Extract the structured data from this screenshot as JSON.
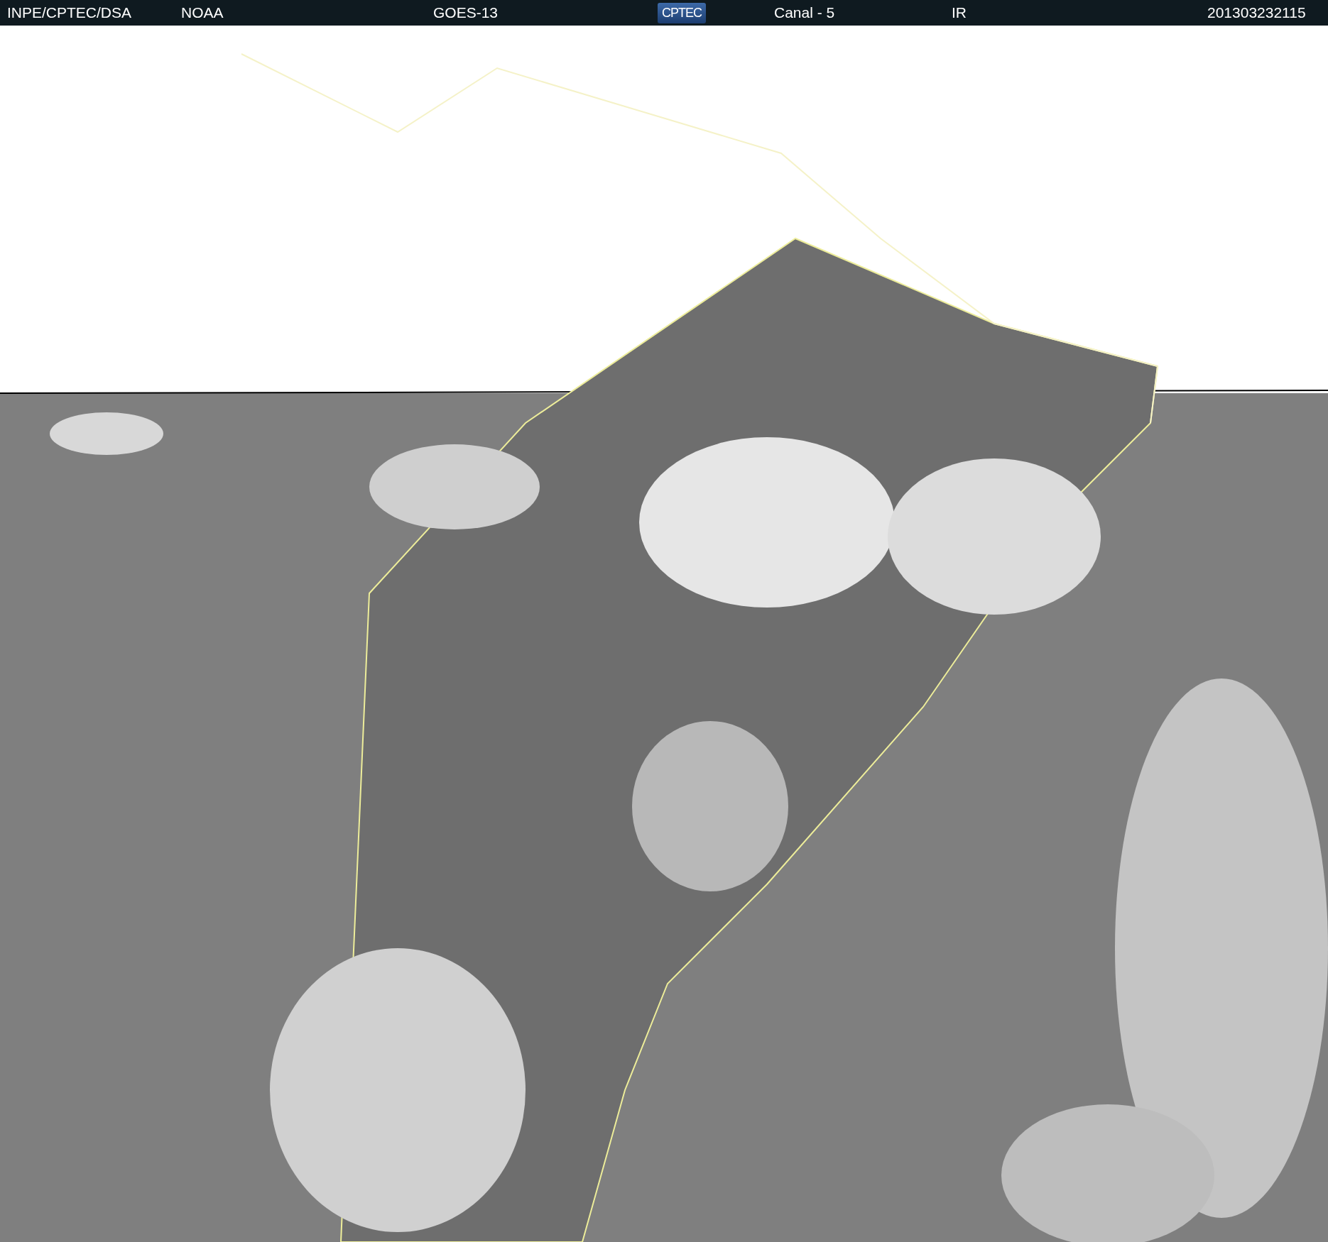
{
  "header": {
    "items": [
      {
        "text": "INPE/CPTEC/DSA"
      },
      {
        "text": "NOAA"
      },
      {
        "text": "GOES-13"
      },
      {
        "text": "CPTEC",
        "kind": "logo"
      },
      {
        "text": "Canal - 5"
      },
      {
        "text": "IR"
      },
      {
        "text": "201303232115"
      }
    ]
  }
}
